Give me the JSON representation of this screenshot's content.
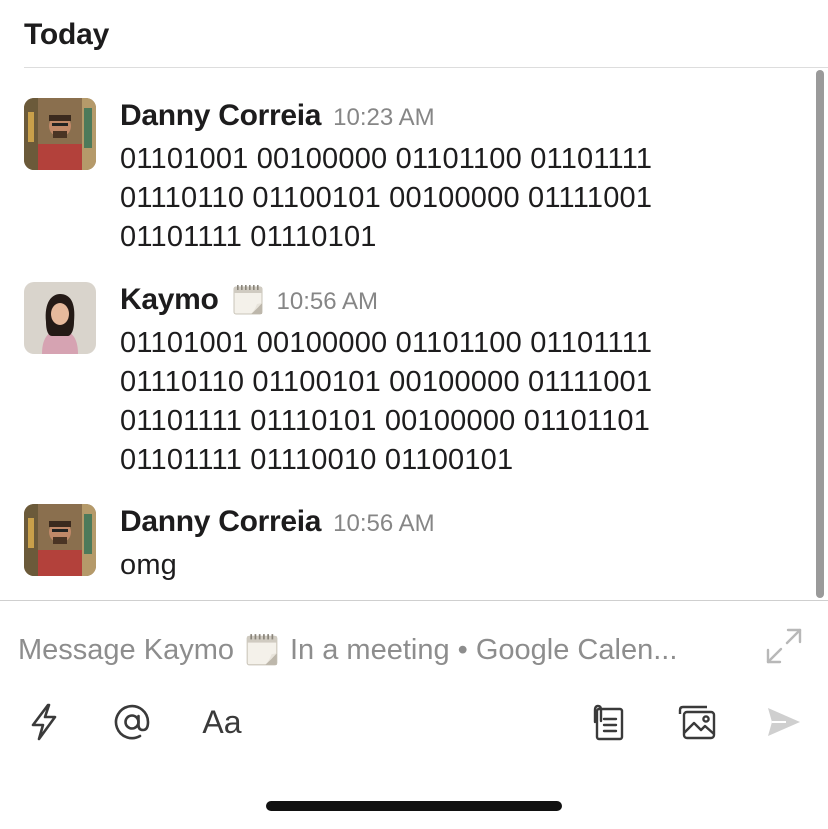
{
  "day_header": "Today",
  "messages": [
    {
      "author": "Danny Correia",
      "time": "10:23 AM",
      "text": "01101001 00100000 01101100 01101111 01110110 01100101 00100000 01111001 01101111 01110101",
      "avatar": "danny-avatar"
    },
    {
      "author": "Kaymo",
      "status_emoji": "calendar-icon",
      "time": "10:56 AM",
      "text": "01101001 00100000 01101100 01101111 01110110 01100101 00100000 01111001 01101111 01110101 00100000 01101101 01101111 01110010 01100101",
      "avatar": "kaymo-avatar"
    },
    {
      "author": "Danny Correia",
      "time": "10:56 AM",
      "text": "omg",
      "avatar": "danny-avatar"
    }
  ],
  "composer": {
    "placeholder_prefix": "Message Kaymo",
    "placeholder_suffix": "In a meeting • Google Calen..."
  },
  "toolbar": {
    "format_label": "Aa"
  },
  "colors": {
    "text": "#1d1c1d",
    "muted": "#868686",
    "icon": "#3a3a3a"
  }
}
